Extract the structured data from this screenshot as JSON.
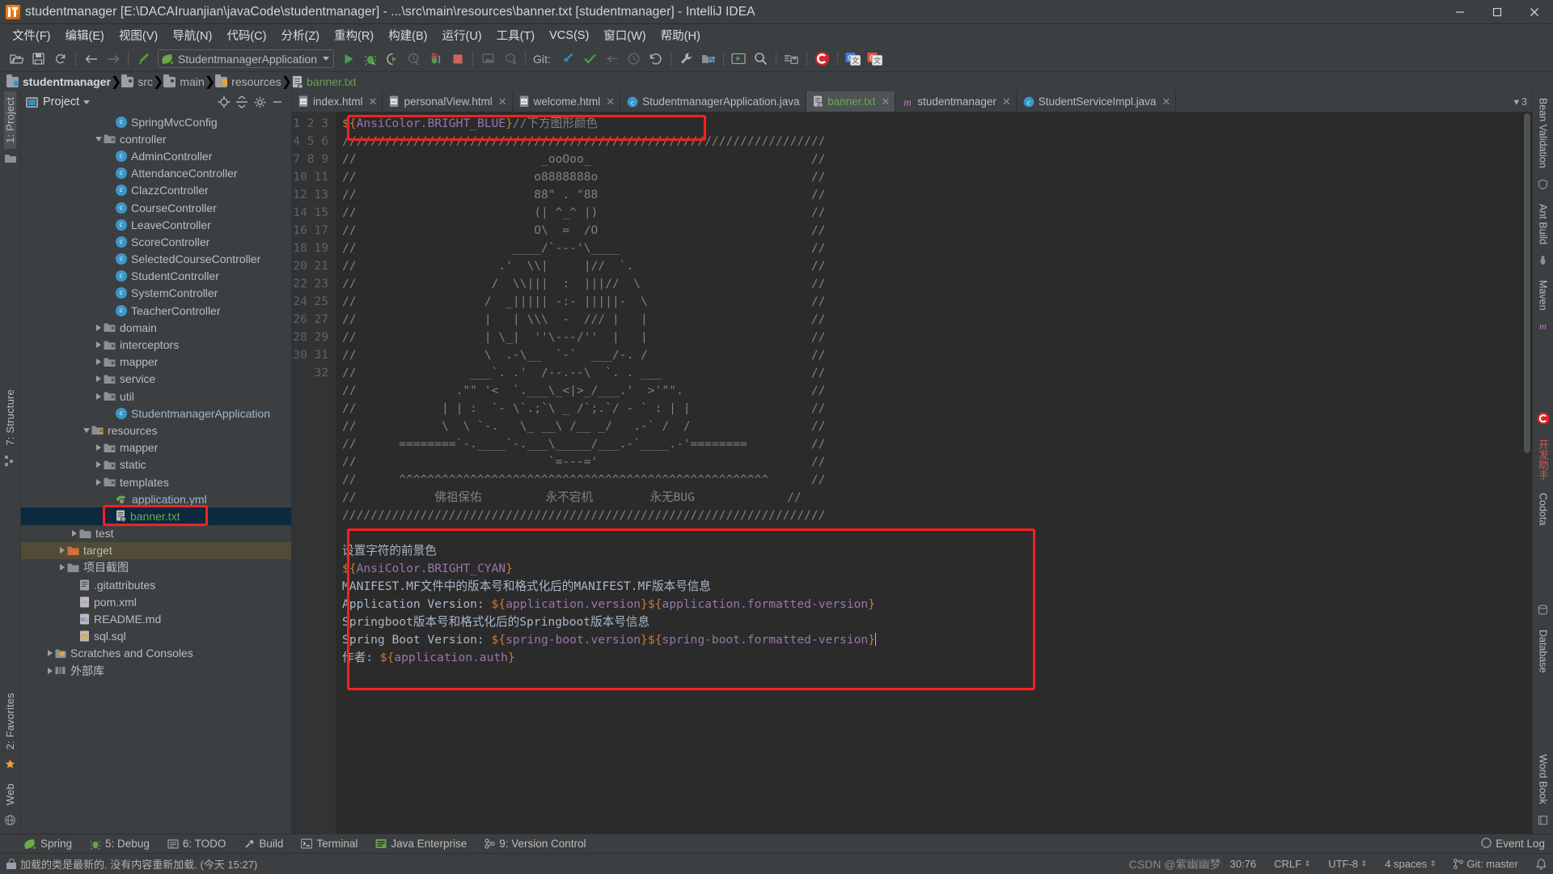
{
  "window": {
    "title": "studentmanager [E:\\DACAIruanjian\\javaCode\\studentmanager] - ...\\src\\main\\resources\\banner.txt [studentmanager] - IntelliJ IDEA",
    "minimize": "–",
    "maximize": "□",
    "close": "✕"
  },
  "menubar": {
    "items": [
      {
        "label": "文件(F)",
        "name": "menu-file"
      },
      {
        "label": "编辑(E)",
        "name": "menu-edit"
      },
      {
        "label": "视图(V)",
        "name": "menu-view"
      },
      {
        "label": "导航(N)",
        "name": "menu-navigate"
      },
      {
        "label": "代码(C)",
        "name": "menu-code"
      },
      {
        "label": "分析(Z)",
        "name": "menu-analyze"
      },
      {
        "label": "重构(R)",
        "name": "menu-refactor"
      },
      {
        "label": "构建(B)",
        "name": "menu-build"
      },
      {
        "label": "运行(U)",
        "name": "menu-run"
      },
      {
        "label": "工具(T)",
        "name": "menu-tools"
      },
      {
        "label": "VCS(S)",
        "name": "menu-vcs"
      },
      {
        "label": "窗口(W)",
        "name": "menu-window"
      },
      {
        "label": "帮助(H)",
        "name": "menu-help"
      }
    ]
  },
  "toolbar": {
    "run_configuration": "StudentmanagerApplication",
    "git_label": "Git:"
  },
  "breadcrumb": {
    "items": [
      {
        "label": "studentmanager",
        "icon": "module-folder-icon"
      },
      {
        "label": "src",
        "icon": "folder-icon"
      },
      {
        "label": "main",
        "icon": "folder-icon"
      },
      {
        "label": "resources",
        "icon": "resources-folder-icon"
      },
      {
        "label": "banner.txt",
        "icon": "text-file-icon"
      }
    ]
  },
  "left_rail": {
    "project_tab": "1: Project",
    "structure_tab": "7: Structure",
    "favorites_tab": "2: Favorites",
    "web_tab": "Web"
  },
  "project_panel": {
    "title": "Project",
    "tree": [
      {
        "label": "SpringMvcConfig",
        "indent": 7,
        "icon": "class",
        "arrow": "none",
        "clip": true
      },
      {
        "label": "controller",
        "indent": 6,
        "icon": "folder",
        "arrow": "down"
      },
      {
        "label": "AdminController",
        "indent": 7,
        "icon": "class",
        "arrow": "none"
      },
      {
        "label": "AttendanceController",
        "indent": 7,
        "icon": "class",
        "arrow": "none"
      },
      {
        "label": "ClazzController",
        "indent": 7,
        "icon": "class",
        "arrow": "none"
      },
      {
        "label": "CourseController",
        "indent": 7,
        "icon": "class",
        "arrow": "none"
      },
      {
        "label": "LeaveController",
        "indent": 7,
        "icon": "class",
        "arrow": "none"
      },
      {
        "label": "ScoreController",
        "indent": 7,
        "icon": "class",
        "arrow": "none"
      },
      {
        "label": "SelectedCourseController",
        "indent": 7,
        "icon": "class",
        "arrow": "none"
      },
      {
        "label": "StudentController",
        "indent": 7,
        "icon": "class",
        "arrow": "none"
      },
      {
        "label": "SystemController",
        "indent": 7,
        "icon": "class",
        "arrow": "none"
      },
      {
        "label": "TeacherController",
        "indent": 7,
        "icon": "class",
        "arrow": "none"
      },
      {
        "label": "domain",
        "indent": 6,
        "icon": "folder",
        "arrow": "right"
      },
      {
        "label": "interceptors",
        "indent": 6,
        "icon": "folder",
        "arrow": "right"
      },
      {
        "label": "mapper",
        "indent": 6,
        "icon": "folder",
        "arrow": "right"
      },
      {
        "label": "service",
        "indent": 6,
        "icon": "folder",
        "arrow": "right"
      },
      {
        "label": "util",
        "indent": 6,
        "icon": "folder",
        "arrow": "right"
      },
      {
        "label": "StudentmanagerApplication",
        "indent": 7,
        "icon": "spring-class",
        "arrow": "none",
        "color": "blue"
      },
      {
        "label": "resources",
        "indent": 5,
        "icon": "resources-folder",
        "arrow": "down"
      },
      {
        "label": "mapper",
        "indent": 6,
        "icon": "folder",
        "arrow": "right"
      },
      {
        "label": "static",
        "indent": 6,
        "icon": "folder",
        "arrow": "right"
      },
      {
        "label": "templates",
        "indent": 6,
        "icon": "folder",
        "arrow": "right"
      },
      {
        "label": "application.yml",
        "indent": 7,
        "icon": "spring-yml",
        "arrow": "none",
        "color": "blue"
      },
      {
        "label": "banner.txt",
        "indent": 7,
        "icon": "text-file",
        "arrow": "none",
        "color": "green",
        "selected": true,
        "highlight": true
      },
      {
        "label": "test",
        "indent": 4,
        "icon": "plain-folder",
        "arrow": "right"
      },
      {
        "label": "target",
        "indent": 3,
        "icon": "orange-folder",
        "arrow": "right",
        "target": true
      },
      {
        "label": "项目截图",
        "indent": 3,
        "icon": "plain-folder",
        "arrow": "right"
      },
      {
        "label": ".gitattributes",
        "indent": 4,
        "icon": "file",
        "arrow": "none"
      },
      {
        "label": "pom.xml",
        "indent": 4,
        "icon": "maven",
        "arrow": "none"
      },
      {
        "label": "README.md",
        "indent": 4,
        "icon": "md",
        "arrow": "none"
      },
      {
        "label": "sql.sql",
        "indent": 4,
        "icon": "sql",
        "arrow": "none"
      },
      {
        "label": "Scratches and Consoles",
        "indent": 2,
        "icon": "scratch",
        "arrow": "right"
      },
      {
        "label": "外部库",
        "indent": 2,
        "icon": "library",
        "arrow": "right"
      }
    ]
  },
  "editor_tabs": {
    "items": [
      {
        "label": "index.html",
        "icon": "html-icon",
        "active": false
      },
      {
        "label": "personalView.html",
        "icon": "html-icon",
        "active": false
      },
      {
        "label": "welcome.html",
        "icon": "html-icon",
        "active": false
      },
      {
        "label": "StudentmanagerApplication.java",
        "icon": "java-icon",
        "active": false
      },
      {
        "label": "banner.txt",
        "icon": "text-file-icon",
        "active": true
      },
      {
        "label": "studentmanager",
        "icon": "maven-icon",
        "active": false
      },
      {
        "label": "StudentServiceImpl.java",
        "icon": "java-icon",
        "active": false
      }
    ],
    "overflow_count": "3"
  },
  "editor": {
    "line_numbers": [
      1,
      2,
      3,
      4,
      5,
      6,
      7,
      8,
      9,
      10,
      11,
      12,
      13,
      14,
      15,
      16,
      17,
      18,
      19,
      20,
      21,
      22,
      23,
      24,
      25,
      26,
      27,
      28,
      29,
      30,
      31,
      32
    ],
    "lines": [
      "${AnsiColor.BRIGHT_BLUE}//下方图形颜色",
      "////////////////////////////////////////////////////////////////////",
      "//                          _ooOoo_                               //",
      "//                         o8888888o                              //",
      "//                         88\" . \"88                              //",
      "//                         (| ^_^ |)                              //",
      "//                         O\\  =  /O                              //",
      "//                      ____/`---'\\____                           //",
      "//                    .'  \\\\|     |//  `.                         //",
      "//                   /  \\\\|||  :  |||//  \\                        //",
      "//                  /  _||||| -:- |||||-  \\                       //",
      "//                  |   | \\\\\\  -  /// |   |                       //",
      "//                  | \\_|  ''\\---/''  |   |                       //",
      "//                  \\  .-\\__  `-`  ___/-. /                       //",
      "//                ___`. .'  /--.--\\  `. . ___                     //",
      "//              .\"\" '<  `.___\\_<|>_/___.'  >'\"\".                  //",
      "//            | | :  `- \\`.;`\\ _ /`;.`/ - ` : | |                 //",
      "//            \\  \\ `-.   \\_ __\\ /__ _/   .-` /  /                 //",
      "//      ========`-.____`-.___\\_____/___.-`____.-'========         //",
      "//                           `=---='                              //",
      "//      ^^^^^^^^^^^^^^^^^^^^^^^^^^^^^^^^^^^^^^^^^^^^^^^^^^^^      //",
      "//           佛祖保佑         永不宕机        永无BUG             //",
      "////////////////////////////////////////////////////////////////////",
      "",
      "设置字符的前景色",
      "${AnsiColor.BRIGHT_CYAN}",
      "MANIFEST.MF文件中的版本号和格式化后的MANIFEST.MF版本号信息",
      "Application Version: ${application.version}${application.formatted-version}",
      "Springboot版本号和格式化后的Springboot版本号信息",
      "Spring Boot Version: ${spring-boot.version}${spring-boot.formatted-version}",
      "作者: ${application.auth}",
      ""
    ]
  },
  "right_rail": {
    "items": [
      {
        "label": "Bean Validation"
      },
      {
        "label": "Ant Build"
      },
      {
        "label": "Maven"
      },
      {
        "label": "开发助手",
        "color": "red"
      },
      {
        "label": "Codota"
      },
      {
        "label": "Database"
      },
      {
        "label": "Word Book"
      }
    ]
  },
  "bottom_bar": {
    "items": [
      {
        "label": "Spring",
        "icon": "spring-leaf-icon"
      },
      {
        "label": "5: Debug",
        "icon": "debug-icon"
      },
      {
        "label": "6: TODO",
        "icon": "todo-icon"
      },
      {
        "label": "Build",
        "icon": "hammer-icon"
      },
      {
        "label": "Terminal",
        "icon": "terminal-icon"
      },
      {
        "label": "Java Enterprise",
        "icon": "java-ee-icon"
      },
      {
        "label": "9: Version Control",
        "icon": "version-control-icon"
      }
    ],
    "event_log": "Event Log"
  },
  "status_bar": {
    "message": "加载的类是最新的. 没有内容重新加载. (今天 15:27)",
    "caret_position": "30:76",
    "line_separator": "CRLF",
    "encoding": "UTF-8",
    "indent": "4 spaces",
    "git_branch": "Git: master",
    "watermark": "CSDN @紫幽幽梦"
  }
}
